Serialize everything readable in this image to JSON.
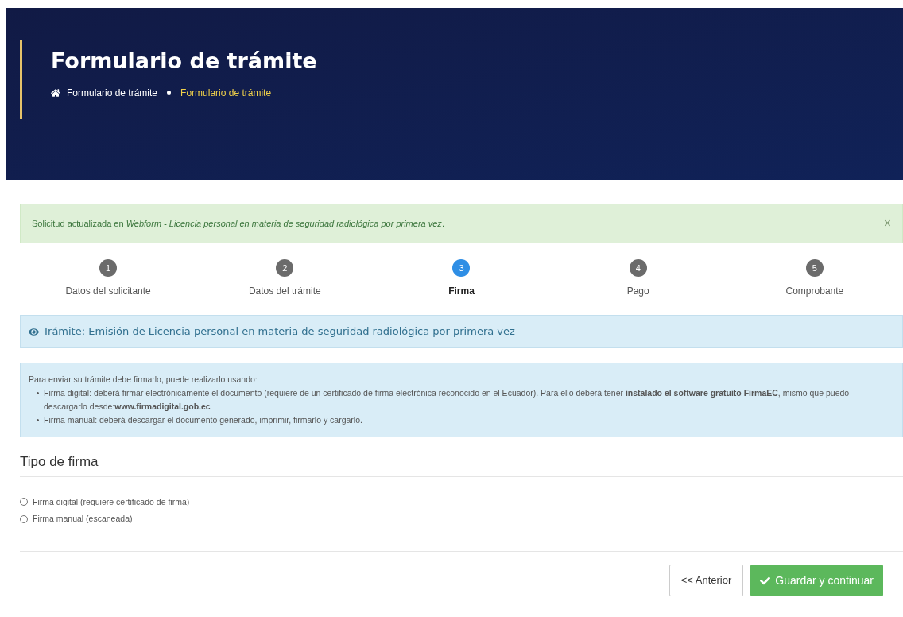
{
  "header": {
    "title": "Formulario de trámite",
    "breadcrumb": [
      {
        "label": "Formulario de trámite",
        "selected": false
      },
      {
        "label": "Formulario de trámite",
        "selected": true
      }
    ]
  },
  "alert": {
    "message": "Solicitud actualizada en *Webform - Licencia personal en materia de seguridad radiológica por primera vez*.",
    "close": "×"
  },
  "steps": [
    {
      "number": "1",
      "label": "Datos del solicitante",
      "selected": false
    },
    {
      "number": "2",
      "label": "Datos del trámite",
      "selected": false
    },
    {
      "number": "3",
      "label": "Firma",
      "selected": true
    },
    {
      "number": "4",
      "label": "Pago",
      "selected": false
    },
    {
      "number": "5",
      "label": "Comprobante",
      "selected": false
    }
  ],
  "procedure_title": "Trámite: Emisión de Licencia personal en materia de seguridad radiológica por primera vez",
  "info": {
    "intro": "Para enviar su trámite debe firmarlo, puede realizarlo usando:",
    "items": [
      "Firma digital: deberá firmar electrónicamente el documento (requiere de un certificado de firma electrónica reconocido en el Ecuador). Para ello deberá tener **instalado el software gratuito FirmaEC**, mismo que puedo descargarlo desde:**www.firmadigital.gob.ec**",
      "Firma manual: deberá descargar el documento generado, imprimir, firmarlo y cargarlo."
    ]
  },
  "signature_type": {
    "heading": "Tipo de firma",
    "options": [
      {
        "label": "Firma digital (requiere certificado de firma)",
        "selected": false
      },
      {
        "label": "Firma manual (escaneada)",
        "selected": false
      }
    ]
  },
  "buttons": {
    "back": "<< Anterior",
    "save": "Guardar y continuar"
  }
}
